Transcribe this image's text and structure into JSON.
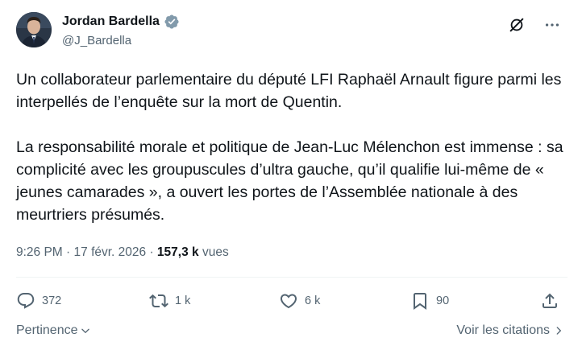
{
  "author": {
    "display_name": "Jordan Bardella",
    "handle": "@J_Bardella",
    "verified_color": "#829aab"
  },
  "tweet": {
    "text": "Un collaborateur parlementaire du député LFI Raphaël Arnault figure parmi les interpellés de l’enquête sur la mort de Quentin.\n\nLa responsabilité morale et politique de Jean-Luc Mélenchon est immense : sa complicité avec les groupuscules d’ultra gauche, qu’il qualifie lui-même de « jeunes camarades », a ouvert les portes de l’Assemblée nationale à des meurtriers présumés.",
    "time": "9:26 PM",
    "separator": " · ",
    "date": "17 févr. 2026",
    "views_count": "157,3 k",
    "views_label": " vues"
  },
  "actions": {
    "replies": "372",
    "reposts": "1 k",
    "likes": "6 k",
    "bookmarks": "90"
  },
  "footer": {
    "sort_label": "Pertinence",
    "quotes_label": "Voir les citations"
  },
  "icons": {
    "grok": "grok-icon",
    "more": "more-icon",
    "reply": "reply-icon",
    "repost": "repost-icon",
    "like": "heart-icon",
    "bookmark": "bookmark-icon",
    "share": "share-icon"
  },
  "colors": {
    "text": "#0f1419",
    "secondary": "#536471",
    "divider": "#eff3f4"
  }
}
